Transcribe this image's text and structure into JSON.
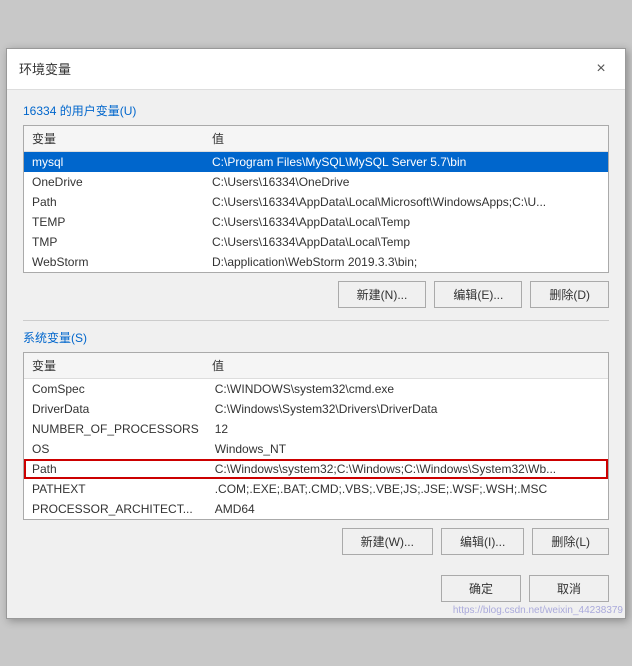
{
  "dialog": {
    "title": "环境变量",
    "close_label": "×"
  },
  "user_section": {
    "label": "16334 的用户变量(U)",
    "columns": [
      "变量",
      "值"
    ],
    "rows": [
      {
        "var": "mysql",
        "val": "C:\\Program Files\\MySQL\\MySQL Server 5.7\\bin",
        "selected": true
      },
      {
        "var": "OneDrive",
        "val": "C:\\Users\\16334\\OneDrive",
        "selected": false
      },
      {
        "var": "Path",
        "val": "C:\\Users\\16334\\AppData\\Local\\Microsoft\\WindowsApps;C:\\U...",
        "selected": false
      },
      {
        "var": "TEMP",
        "val": "C:\\Users\\16334\\AppData\\Local\\Temp",
        "selected": false
      },
      {
        "var": "TMP",
        "val": "C:\\Users\\16334\\AppData\\Local\\Temp",
        "selected": false
      },
      {
        "var": "WebStorm",
        "val": "D:\\application\\WebStorm 2019.3.3\\bin;",
        "selected": false
      }
    ],
    "buttons": {
      "new": "新建(N)...",
      "edit": "编辑(E)...",
      "delete": "删除(D)"
    }
  },
  "system_section": {
    "label": "系统变量(S)",
    "columns": [
      "变量",
      "值"
    ],
    "rows": [
      {
        "var": "ComSpec",
        "val": "C:\\WINDOWS\\system32\\cmd.exe",
        "selected": false,
        "highlighted": false
      },
      {
        "var": "DriverData",
        "val": "C:\\Windows\\System32\\Drivers\\DriverData",
        "selected": false,
        "highlighted": false
      },
      {
        "var": "NUMBER_OF_PROCESSORS",
        "val": "12",
        "selected": false,
        "highlighted": false
      },
      {
        "var": "OS",
        "val": "Windows_NT",
        "selected": false,
        "highlighted": false
      },
      {
        "var": "Path",
        "val": "C:\\Windows\\system32;C:\\Windows;C:\\Windows\\System32\\Wb...",
        "selected": false,
        "highlighted": true
      },
      {
        "var": "PATHEXT",
        "val": ".COM;.EXE;.BAT;.CMD;.VBS;.VBE;JS;.JSE;.WSF;.WSH;.MSC",
        "selected": false,
        "highlighted": false
      },
      {
        "var": "PROCESSOR_ARCHITECT...",
        "val": "AMD64",
        "selected": false,
        "highlighted": false
      }
    ],
    "buttons": {
      "new": "新建(W)...",
      "edit": "编辑(I)...",
      "delete": "删除(L)"
    }
  },
  "footer": {
    "ok": "确定",
    "cancel": "取消"
  },
  "watermark": "https://blog.csdn.net/weixin_44238379"
}
